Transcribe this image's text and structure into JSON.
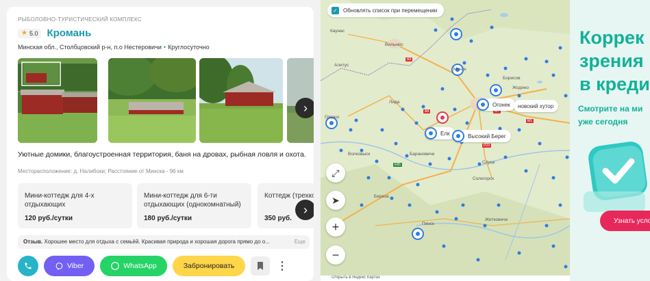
{
  "listing": {
    "category": "РЫБОЛОВНО-ТУРИСТИЧЕСКИЙ КОМПЛЕКС",
    "rating": "5.0",
    "name": "Кромань",
    "address": "Минская обл., Столбцовский р-н, п.о Нестеровичи",
    "hours": "Круглосуточно",
    "description": "Уютные домики, благоустроенная территория, баня на дровах, рыбная ловля и охота.",
    "location_meta": "Месторасположение: д. Налибоки; Расстояние от Минска - 96 км",
    "offers": [
      {
        "title": "Мини-коттедж для 4-х отдыхающих",
        "price": "120 руб./сутки"
      },
      {
        "title": "Мини-коттедж для 6-ти отдыхающих (однокомнатный)",
        "price": "180 руб./сутки"
      },
      {
        "title": "Коттедж (трехко",
        "price": "350 руб."
      }
    ],
    "review": {
      "label": "Отзыв.",
      "text": "Хорошее место для отдыха с семьёй. Красивая природа и хорошая дорога прямо до о...",
      "more": "Еще"
    },
    "actions": {
      "viber": "Viber",
      "whatsapp": "WhatsApp",
      "book": "Забронировать"
    },
    "colors": {
      "accent": "#1a9ab0",
      "viber": "#7360f2",
      "whatsapp": "#25d366",
      "book": "#ffd54a"
    }
  },
  "map": {
    "update_checkbox_label": "Обновлять список при перемещении",
    "update_checked": true,
    "labels": {
      "ogonek": "Огонек",
      "hutor": "новский хутор",
      "elk": "Елк",
      "vysokiy": "Высокий Берег"
    },
    "cities": [
      "Каунас",
      "Вильнюс",
      "Алитус",
      "Лида",
      "Гродно",
      "Минск",
      "Борисов",
      "Жодино",
      "Слуцк",
      "Солигорск",
      "Барановичи",
      "Пинск",
      "Береза",
      "Волковыск",
      "Житковичи"
    ],
    "roads": [
      "A3",
      "A8",
      "M7",
      "M1",
      "E85",
      "P23"
    ],
    "bottom_text": "Открыть в Яндекс Картах"
  },
  "ad": {
    "headline_lines": [
      "Коррек",
      "зрения",
      "в креди"
    ],
    "sub_lines": [
      "Смотрите на ми",
      "уже сегодня"
    ],
    "button": "Узнать усло"
  }
}
